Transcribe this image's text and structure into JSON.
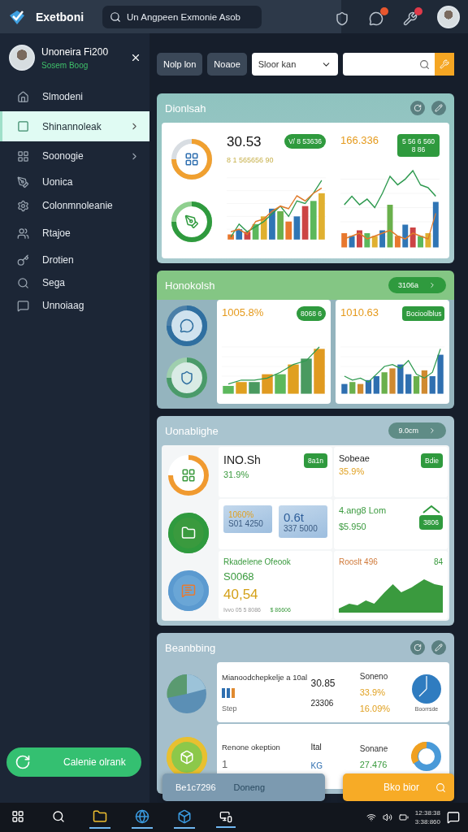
{
  "topbar": {
    "app_name": "Exetboni",
    "search": {
      "placeholder": "Un Angpeen Exmonie Asob"
    }
  },
  "sidebar": {
    "profile": {
      "name": "Unoneira Fi200",
      "status": "Sosem Boog"
    },
    "items": [
      {
        "label": "Slmodeni",
        "selected": false,
        "has_submenu": false
      },
      {
        "label": "Shinannoleak",
        "selected": true,
        "has_submenu": true
      },
      {
        "label": "Soonogie",
        "selected": false,
        "has_submenu": true
      },
      {
        "label": "Uonica",
        "selected": false,
        "has_submenu": false
      },
      {
        "label": "Colonmnoleanie",
        "selected": false,
        "has_submenu": false
      },
      {
        "label": "Rtajoe",
        "selected": false,
        "has_submenu": false
      },
      {
        "label": "Drotien",
        "selected": false,
        "has_submenu": false
      },
      {
        "label": "Sega",
        "selected": false,
        "has_submenu": false
      },
      {
        "label": "Unnoiaag",
        "selected": false,
        "has_submenu": false
      }
    ],
    "action_button": "Calenie olrank"
  },
  "toolbar": {
    "buttons": [
      "Nolp lon",
      "Noaoe"
    ],
    "select": {
      "value": "Sloor kan"
    }
  },
  "panels": [
    {
      "kind": "charts",
      "title": "Dionlsah",
      "cards": [
        {
          "value": "30.53",
          "subtitle": "8 1 565656 90",
          "badge": "V/ 8 53636"
        },
        {
          "value": "166.336",
          "badge": "5 56 6 560 8 86"
        }
      ]
    },
    {
      "kind": "charts",
      "title": "Honokolsh",
      "pill": "3106a",
      "cards": [
        {
          "value": "1005.8%",
          "badge": "8068 6"
        },
        {
          "value": "1010.63",
          "badge": "Bocioolblus"
        }
      ]
    },
    {
      "kind": "stats",
      "title": "Uonablighe",
      "pill": "9.0cm"
    },
    {
      "kind": "table",
      "title": "Beanbbing"
    }
  ],
  "stats": {
    "cells": [
      {
        "title": "INO.Sh",
        "value": "31.9%",
        "badge": "8a1n"
      },
      {
        "title": "Sobeae",
        "value": "35.9%",
        "badge": "Bdie"
      }
    ],
    "tiles": [
      {
        "value": "1060%",
        "note": "S01 4250"
      },
      {
        "value": "0.6t",
        "note": "337 5000"
      }
    ],
    "growth": {
      "title": "4.ang8 Lom",
      "value": "$5.950",
      "badge": "3806"
    },
    "revenue": {
      "title": "Rkadelene Ofeook",
      "value": "S0068",
      "amount": "40,54",
      "note": "Ivvo 05 5 8086",
      "trend": "$ 86606"
    },
    "area": {
      "title": "Rooslt 496",
      "corner": "84"
    }
  },
  "table": {
    "rows": [
      {
        "title": "Mianoodchepkelje a 10al",
        "label_2": "Step",
        "col_2": [
          "30.85",
          "23306"
        ],
        "col_3_head": "Soneno",
        "col_3": [
          "33.9%",
          "16.09%"
        ],
        "caption": "Boorrsde"
      },
      {
        "title": "Renone okeption",
        "label_2": "1",
        "col_2": [
          "Ital",
          "KG"
        ],
        "col_3_head": "Sonane",
        "col_3": [
          "27.476"
        ]
      }
    ]
  },
  "bottom_bar": {
    "value": "Be1c7296",
    "label": "Doneng",
    "action": "Bko bior"
  },
  "taskbar": {
    "clock": [
      "12:38:38",
      "3:38:860"
    ]
  }
}
